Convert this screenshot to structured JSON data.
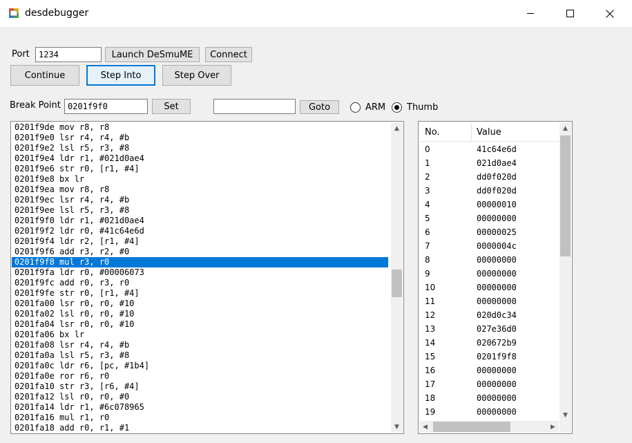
{
  "window": {
    "title": "desdebugger"
  },
  "connection": {
    "port_label": "Port",
    "port_value": "1234",
    "launch_label": "Launch DeSmuME",
    "connect_label": "Connect"
  },
  "controls": {
    "continue_label": "Continue",
    "step_into_label": "Step Into",
    "step_over_label": "Step Over"
  },
  "breakpoint": {
    "label": "Break Point",
    "value": "0201f9f0",
    "set_label": "Set",
    "goto_value": "",
    "goto_label": "Goto"
  },
  "mode": {
    "arm_label": "ARM",
    "thumb_label": "Thumb",
    "selected": "Thumb"
  },
  "disassembly": {
    "selected_index": 13,
    "lines": [
      "0201f9de mov r8, r8",
      "0201f9e0 lsr r4, r4, #b",
      "0201f9e2 lsl r5, r3, #8",
      "0201f9e4 ldr r1, #021d0ae4",
      "0201f9e6 str r0, [r1, #4]",
      "0201f9e8 bx lr",
      "0201f9ea mov r8, r8",
      "0201f9ec lsr r4, r4, #b",
      "0201f9ee lsl r5, r3, #8",
      "0201f9f0 ldr r1, #021d0ae4",
      "0201f9f2 ldr r0, #41c64e6d",
      "0201f9f4 ldr r2, [r1, #4]",
      "0201f9f6 add r3, r2, #0",
      "0201f9f8 mul r3, r0",
      "0201f9fa ldr r0, #00006073",
      "0201f9fc add r0, r3, r0",
      "0201f9fe str r0, [r1, #4]",
      "0201fa00 lsr r0, r0, #10",
      "0201fa02 lsl r0, r0, #10",
      "0201fa04 lsr r0, r0, #10",
      "0201fa06 bx lr",
      "0201fa08 lsr r4, r4, #b",
      "0201fa0a lsl r5, r3, #8",
      "0201fa0c ldr r6, [pc, #1b4]",
      "0201fa0e ror r6, r0",
      "0201fa10 str r3, [r6, #4]",
      "0201fa12 lsl r0, r0, #0",
      "0201fa14 ldr r1, #6c078965",
      "0201fa16 mul r1, r0",
      "0201fa18 add r0, r1, #1"
    ]
  },
  "registers": {
    "header_no": "No.",
    "header_value": "Value",
    "rows": [
      {
        "no": "0",
        "value": "41c64e6d"
      },
      {
        "no": "1",
        "value": "021d0ae4"
      },
      {
        "no": "2",
        "value": "dd0f020d"
      },
      {
        "no": "3",
        "value": "dd0f020d"
      },
      {
        "no": "4",
        "value": "00000010"
      },
      {
        "no": "5",
        "value": "00000000"
      },
      {
        "no": "6",
        "value": "00000025"
      },
      {
        "no": "7",
        "value": "0000004c"
      },
      {
        "no": "8",
        "value": "00000000"
      },
      {
        "no": "9",
        "value": "00000000"
      },
      {
        "no": "10",
        "value": "00000000"
      },
      {
        "no": "11",
        "value": "00000000"
      },
      {
        "no": "12",
        "value": "020d0c34"
      },
      {
        "no": "13",
        "value": "027e36d0"
      },
      {
        "no": "14",
        "value": "020672b9"
      },
      {
        "no": "15",
        "value": "0201f9f8"
      },
      {
        "no": "16",
        "value": "00000000"
      },
      {
        "no": "17",
        "value": "00000000"
      },
      {
        "no": "18",
        "value": "00000000"
      },
      {
        "no": "19",
        "value": "00000000"
      }
    ]
  },
  "icons": {
    "app": "app-icon",
    "minimize": "minimize-icon",
    "maximize": "maximize-icon",
    "close": "close-icon"
  },
  "colors": {
    "selection": "#0078d7",
    "focus_border": "#0078d7"
  }
}
